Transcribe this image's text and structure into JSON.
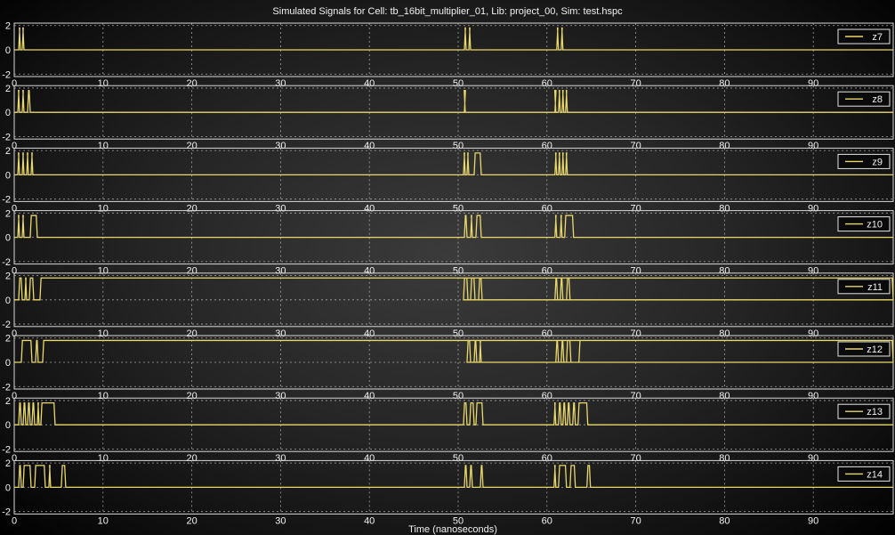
{
  "chart_data": {
    "type": "line",
    "title": "Simulated Signals for Cell: tb_16bit_multiplier_01, Lib: project_00, Sim: test.hspc",
    "xlabel": "Time (nanoseconds)",
    "xlim": [
      0,
      99
    ],
    "ylim": [
      -2.2,
      2.2
    ],
    "xticks": [
      "0",
      "10",
      "20",
      "30",
      "40",
      "50",
      "60",
      "70",
      "80",
      "90"
    ],
    "yticks": [
      "2",
      "0",
      "-2"
    ],
    "grid": true,
    "legend_position": "top-right",
    "trace_color": "#e9d86a",
    "series": [
      {
        "name": "z7",
        "pulses": [
          [
            0.5,
            0.7
          ],
          [
            0.9,
            1.1
          ],
          [
            50.7,
            50.9
          ],
          [
            51.2,
            51.4
          ],
          [
            61.1,
            61.3
          ],
          [
            61.6,
            61.8
          ]
        ]
      },
      {
        "name": "z8",
        "pulses": [
          [
            0.4,
            0.6
          ],
          [
            0.9,
            1.1
          ],
          [
            1.5,
            1.8
          ],
          [
            50.7,
            50.8
          ],
          [
            60.9,
            61.0
          ],
          [
            61.3,
            61.5
          ],
          [
            61.7,
            61.9
          ],
          [
            62.1,
            62.3
          ]
        ]
      },
      {
        "name": "z9",
        "pulses": [
          [
            0.4,
            0.6
          ],
          [
            0.9,
            1.1
          ],
          [
            1.4,
            1.6
          ],
          [
            1.9,
            2.1
          ],
          [
            50.6,
            50.8
          ],
          [
            51.0,
            51.2
          ],
          [
            51.8,
            52.6
          ],
          [
            60.9,
            61.1
          ],
          [
            61.3,
            61.5
          ],
          [
            61.7,
            61.9
          ],
          [
            62.1,
            62.3
          ]
        ]
      },
      {
        "name": "z10",
        "pulses": [
          [
            0.4,
            0.6
          ],
          [
            0.9,
            1.1
          ],
          [
            1.8,
            2.6
          ],
          [
            50.7,
            51.0
          ],
          [
            51.4,
            51.6
          ],
          [
            52.0,
            52.6
          ],
          [
            60.9,
            61.1
          ],
          [
            61.5,
            61.7
          ],
          [
            62.0,
            63.0
          ]
        ]
      },
      {
        "name": "z11",
        "pulses": [
          [
            0.5,
            0.9
          ],
          [
            1.2,
            1.4
          ],
          [
            1.7,
            2.2
          ],
          [
            2.9,
            100
          ],
          [
            50.6,
            51.1
          ],
          [
            51.4,
            51.9
          ],
          [
            52.3,
            52.7
          ],
          [
            60.9,
            61.2
          ],
          [
            61.5,
            61.8
          ],
          [
            62.2,
            62.6
          ]
        ]
      },
      {
        "name": "z12",
        "pulses": [
          [
            0.8,
            2.0
          ],
          [
            2.4,
            2.7
          ],
          [
            3.2,
            100
          ],
          [
            51.0,
            51.4
          ],
          [
            51.8,
            52.1
          ],
          [
            52.4,
            52.6
          ],
          [
            61.0,
            61.3
          ],
          [
            61.6,
            61.9
          ],
          [
            62.2,
            62.7
          ],
          [
            63.6,
            100
          ]
        ]
      },
      {
        "name": "z13",
        "pulses": [
          [
            0.5,
            0.8
          ],
          [
            1.0,
            1.3
          ],
          [
            1.5,
            1.8
          ],
          [
            2.0,
            2.3
          ],
          [
            2.6,
            2.8
          ],
          [
            3.0,
            4.6
          ],
          [
            50.6,
            51.0
          ],
          [
            51.3,
            51.8
          ],
          [
            52.0,
            52.8
          ],
          [
            60.8,
            61.0
          ],
          [
            61.3,
            61.6
          ],
          [
            61.8,
            62.1
          ],
          [
            62.3,
            62.6
          ],
          [
            62.9,
            63.2
          ],
          [
            63.5,
            64.6
          ]
        ]
      },
      {
        "name": "z14",
        "pulses": [
          [
            0.5,
            0.8
          ],
          [
            1.0,
            1.9
          ],
          [
            2.3,
            3.5
          ],
          [
            3.9,
            4.1
          ],
          [
            5.3,
            5.8
          ],
          [
            50.7,
            51.0
          ],
          [
            51.3,
            51.6
          ],
          [
            52.5,
            52.8
          ],
          [
            60.8,
            61.0
          ],
          [
            61.3,
            62.2
          ],
          [
            62.6,
            63.2
          ],
          [
            64.5,
            64.9
          ]
        ]
      }
    ]
  }
}
